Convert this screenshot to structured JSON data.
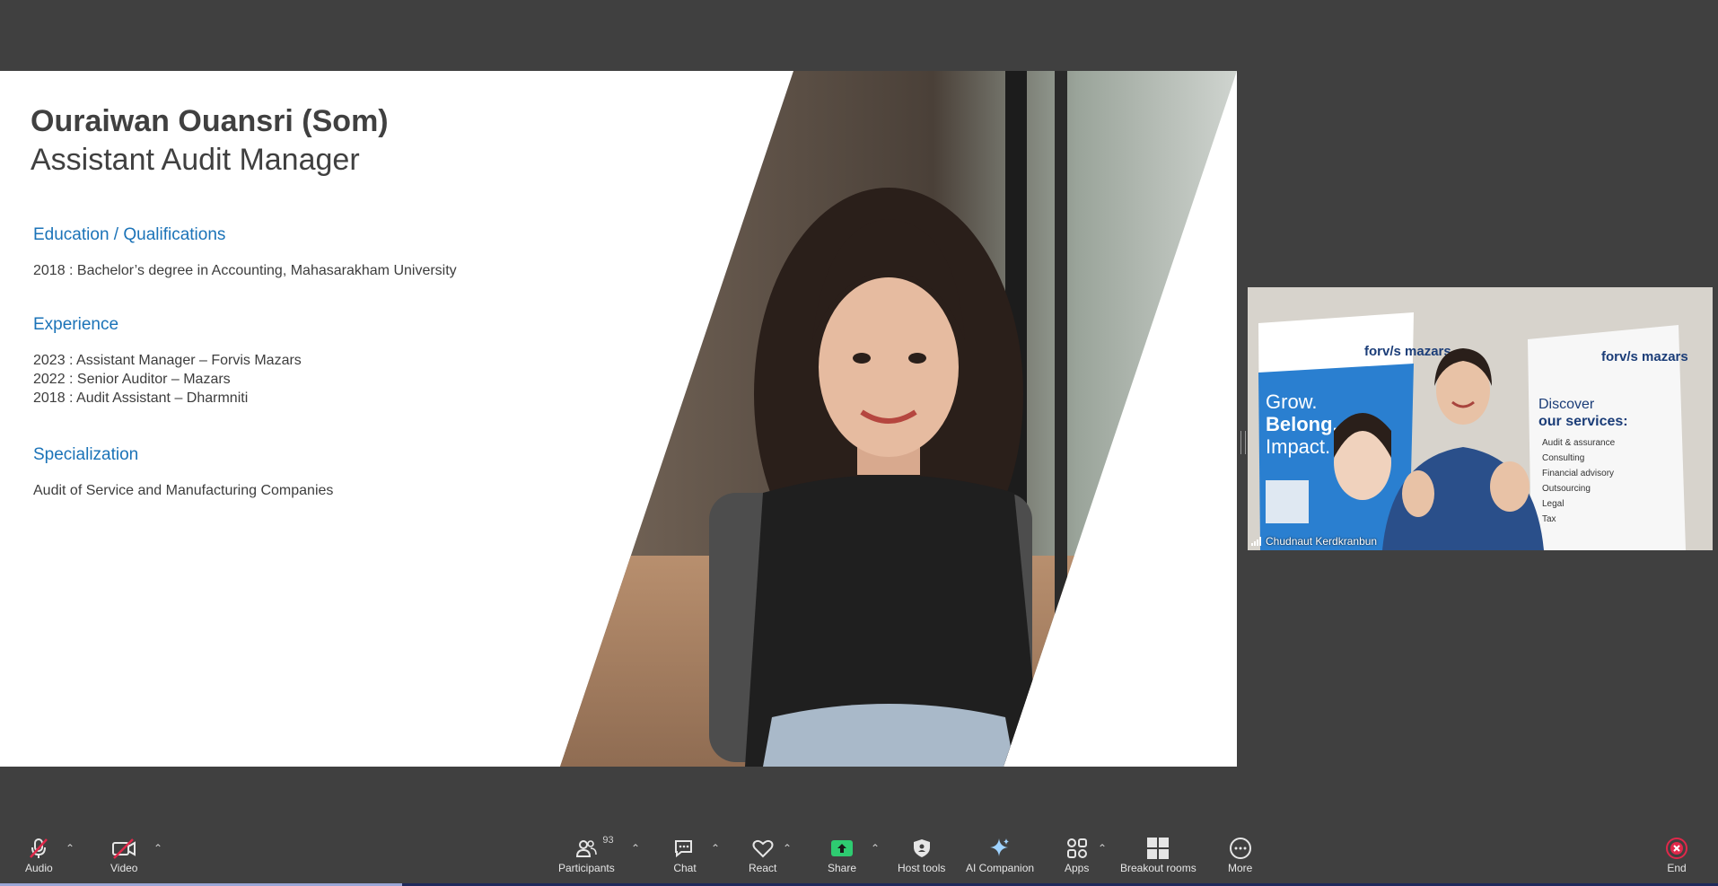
{
  "slide": {
    "name": "Ouraiwan Ouansri (Som)",
    "role": "Assistant Audit Manager",
    "sections": [
      {
        "heading": "Education / Qualifications",
        "lines": [
          "2018 : Bachelor’s degree in Accounting, Mahasarakham University"
        ]
      },
      {
        "heading": "Experience",
        "lines": [
          "2023 : Assistant Manager – Forvis Mazars",
          "2022 : Senior Auditor – Mazars",
          "2018 : Audit Assistant – Dharmniti"
        ]
      },
      {
        "heading": "Specialization",
        "lines": [
          "Audit of Service and Manufacturing Companies"
        ]
      }
    ]
  },
  "video_tile": {
    "participant_name": "Chudnaut Kerdkranbun",
    "banner_left": {
      "brand": "forv/s mazars",
      "slogan_1": "Grow.",
      "slogan_2": "Belong.",
      "slogan_3": "Impact."
    },
    "banner_right": {
      "brand": "forv/s mazars",
      "title_1": "Discover",
      "title_2": "our services:",
      "items": [
        "Audit & assurance",
        "Consulting",
        "Financial advisory",
        "Outsourcing",
        "Legal",
        "Tax"
      ]
    }
  },
  "toolbar": {
    "audio": "Audio",
    "video": "Video",
    "participants": "Participants",
    "participants_count": "93",
    "chat": "Chat",
    "react": "React",
    "share": "Share",
    "host_tools": "Host tools",
    "ai_companion": "AI Companion",
    "apps": "Apps",
    "breakout_rooms": "Breakout rooms",
    "more": "More",
    "end": "End"
  },
  "colors": {
    "background": "#404040",
    "heading_blue": "#1b73b8",
    "share_green": "#2ecc71",
    "end_red": "#e0284a"
  }
}
